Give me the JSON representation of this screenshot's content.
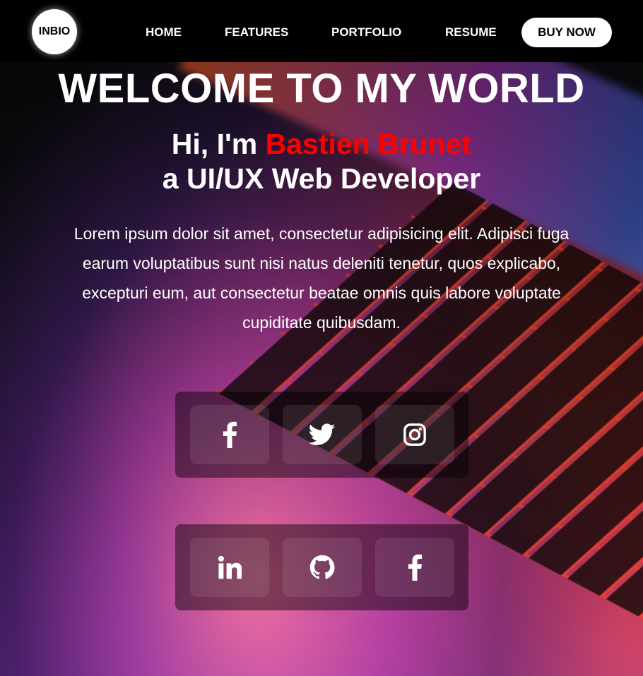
{
  "header": {
    "logo": "INBIO",
    "nav": [
      "HOME",
      "FEATURES",
      "PORTFOLIO",
      "RESUME"
    ],
    "cta": "BUY NOW"
  },
  "hero": {
    "title": "WELCOME TO MY WORLD",
    "greeting_prefix": "Hi, I'm ",
    "name": "Bastien Brunet",
    "role": "a UI/UX Web Developer",
    "description": "Lorem ipsum dolor sit amet, consectetur adipisicing elit. Adipisci fuga earum voluptatibus sunt nisi natus deleniti tenetur, quos explicabo, excepturi eum, aut consectetur beatae omnis quis labore voluptate cupiditate quibusdam."
  },
  "social": {
    "row1": [
      "facebook-icon",
      "twitter-icon",
      "instagram-icon"
    ],
    "row2": [
      "linkedin-icon",
      "github-icon",
      "facebook-icon"
    ]
  },
  "colors": {
    "accent_name": "#ff0000",
    "header_bg": "#000000",
    "text": "#ffffff"
  }
}
